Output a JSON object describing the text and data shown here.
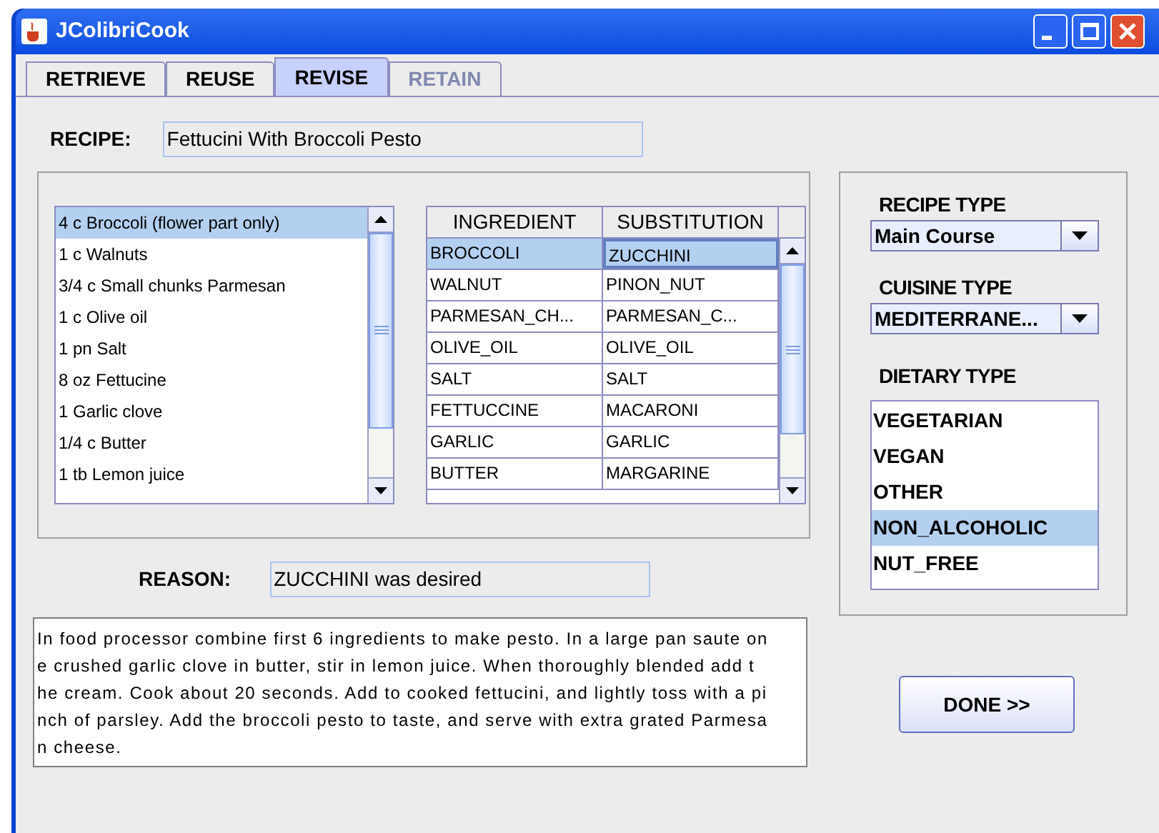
{
  "window": {
    "title": "JColibriCook"
  },
  "tabs": [
    {
      "label": "RETRIEVE",
      "selected": false,
      "disabled": false
    },
    {
      "label": "REUSE",
      "selected": false,
      "disabled": false
    },
    {
      "label": "REVISE",
      "selected": true,
      "disabled": false
    },
    {
      "label": "RETAIN",
      "selected": false,
      "disabled": true
    }
  ],
  "recipe": {
    "label": "RECIPE:",
    "value": "Fettucini With Broccoli Pesto"
  },
  "ingredients": [
    {
      "text": "4 c Broccoli (flower part only)",
      "selected": true
    },
    {
      "text": "1 c Walnuts",
      "selected": false
    },
    {
      "text": "3/4 c Small chunks Parmesan",
      "selected": false
    },
    {
      "text": "1 c Olive oil",
      "selected": false
    },
    {
      "text": "1 pn Salt",
      "selected": false
    },
    {
      "text": "8 oz Fettucine",
      "selected": false
    },
    {
      "text": "1 Garlic clove",
      "selected": false
    },
    {
      "text": "1/4 c Butter",
      "selected": false
    },
    {
      "text": "1 tb Lemon juice",
      "selected": false
    }
  ],
  "table": {
    "columns": [
      "INGREDIENT",
      "SUBSTITUTION"
    ],
    "rows": [
      {
        "cells": [
          "BROCCOLI",
          "ZUCCHINI"
        ],
        "selected": true
      },
      {
        "cells": [
          "WALNUT",
          "PINON_NUT"
        ],
        "selected": false
      },
      {
        "cells": [
          "PARMESAN_CH...",
          "PARMESAN_C..."
        ],
        "selected": false
      },
      {
        "cells": [
          "OLIVE_OIL",
          "OLIVE_OIL"
        ],
        "selected": false
      },
      {
        "cells": [
          "SALT",
          "SALT"
        ],
        "selected": false
      },
      {
        "cells": [
          "FETTUCCINE",
          "MACARONI"
        ],
        "selected": false
      },
      {
        "cells": [
          "GARLIC",
          "GARLIC"
        ],
        "selected": false
      },
      {
        "cells": [
          "BUTTER",
          "MARGARINE"
        ],
        "selected": false
      }
    ]
  },
  "reason": {
    "label": "REASON:",
    "value": "ZUCCHINI was desired"
  },
  "instructions": [
    "In food processor combine first 6 ingredients to make pesto. In a large pan saute on",
    "e crushed garlic clove in butter, stir in lemon juice. When thoroughly blended add t",
    "he cream. Cook about 20 seconds. Add to cooked fettucini, and lightly toss with a pi",
    "nch of parsley. Add the broccoli pesto to taste, and serve with extra grated Parmesa",
    "n cheese."
  ],
  "recipe_type": {
    "label": "RECIPE TYPE",
    "value": "Main  Course"
  },
  "cuisine_type": {
    "label": "CUISINE TYPE",
    "value": "MEDITERRANE..."
  },
  "dietary_type": {
    "label": "DIETARY TYPE",
    "items": [
      {
        "text": "VEGETARIAN",
        "selected": false
      },
      {
        "text": "VEGAN",
        "selected": false
      },
      {
        "text": "OTHER",
        "selected": false
      },
      {
        "text": "NON_ALCOHOLIC",
        "selected": true
      },
      {
        "text": "NUT_FREE",
        "selected": false
      }
    ]
  },
  "done_button": "DONE >>"
}
